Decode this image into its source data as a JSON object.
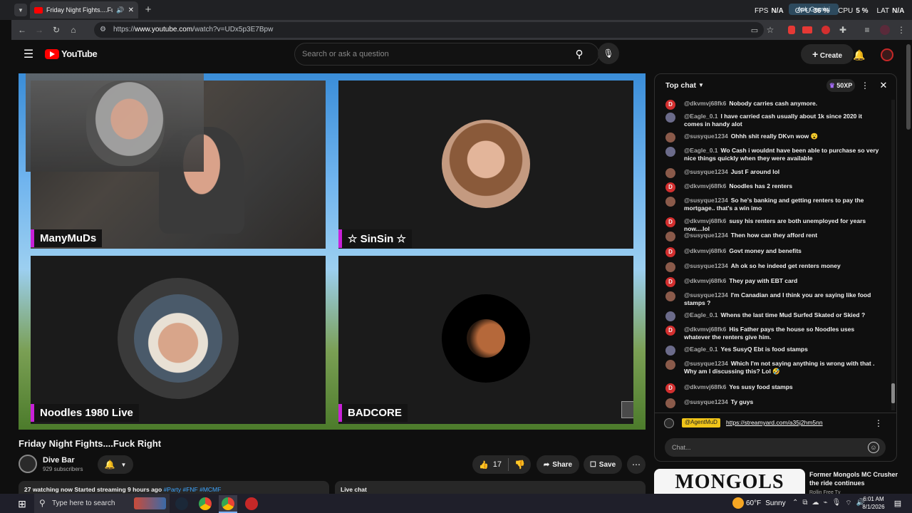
{
  "browser": {
    "tab_title": "Friday Night Fights....Fuck R",
    "url": "https://www.youtube.com/watch?v=UDx5p3E7Bpw",
    "url_prefix": "https://",
    "url_domain": "www.youtube.com",
    "url_path": "/watch?v=UDx5p3E7Bpw",
    "ask_label": "Ask Gemini",
    "perf": {
      "fps_label": "FPS",
      "fps": "N/A",
      "gpu_label": "GPU",
      "gpu": "36 %",
      "cpu_label": "CPU",
      "cpu": "5 %",
      "lat_label": "LAT",
      "lat": "N/A"
    }
  },
  "youtube": {
    "logo": "YouTube",
    "search_placeholder": "Search or ask a question",
    "create_label": "Create"
  },
  "video": {
    "participants": [
      {
        "name": "ManyMuDs"
      },
      {
        "name": "☆ SinSin ☆"
      },
      {
        "name": "Noodles 1980 Live"
      },
      {
        "name": "BADCORE"
      }
    ],
    "title": "Friday Night Fights....Fuck Right",
    "channel_name": "Dive Bar",
    "subscribers": "929 subscribers",
    "likes": "17",
    "share_label": "Share",
    "save_label": "Save",
    "stats": "27 watching now  Started streaming 9 hours ago",
    "hashtags": "#Party #FNF #MCMF",
    "live_chat_label": "Live chat"
  },
  "chat": {
    "mode": "Top chat",
    "xp": "50XP",
    "pinned_user": "@AgentMuD",
    "pinned_link": "https://streamyard.com/a35j2hm5nn",
    "input_placeholder": "Chat...",
    "messages": [
      {
        "user": "@dkvmvj68fk6",
        "text": "Nobody carries cash anymore.",
        "avatar": "D",
        "color": "#d32f2f"
      },
      {
        "user": "@Eagle_0.1",
        "text": "I have carried cash usually about 1k since 2020 it comes in handy alot",
        "avatar": "",
        "color": "#6b6b8a"
      },
      {
        "user": "@susyque1234",
        "text": "Ohhh shit really DKvn wow 😮",
        "avatar": "",
        "color": "#8a5a4a"
      },
      {
        "user": "@Eagle_0.1",
        "text": "Wo Cash i wouldnt have been able to purchase so very nice things quickly when they were available",
        "avatar": "",
        "color": "#6b6b8a"
      },
      {
        "user": "@susyque1234",
        "text": "Just F around lol",
        "avatar": "",
        "color": "#8a5a4a"
      },
      {
        "user": "@dkvmvj68fk6",
        "text": "Noodles has 2 renters",
        "avatar": "D",
        "color": "#d32f2f"
      },
      {
        "user": "@susyque1234",
        "text": "So he's banking and getting renters to pay the mortgage.. that's a win imo",
        "avatar": "",
        "color": "#8a5a4a"
      },
      {
        "user": "@dkvmvj68fk6",
        "text": "susy his renters are both unemployed for years now....lol",
        "avatar": "D",
        "color": "#d32f2f"
      },
      {
        "user": "@susyque1234",
        "text": "Then how can they afford rent",
        "avatar": "",
        "color": "#8a5a4a"
      },
      {
        "user": "@dkvmvj68fk6",
        "text": "Govt money and benefits",
        "avatar": "D",
        "color": "#d32f2f"
      },
      {
        "user": "@susyque1234",
        "text": "Ah ok so he indeed get renters money",
        "avatar": "",
        "color": "#8a5a4a"
      },
      {
        "user": "@dkvmvj68fk6",
        "text": "They pay with EBT card",
        "avatar": "D",
        "color": "#d32f2f"
      },
      {
        "user": "@susyque1234",
        "text": "I'm Canadian and I think you are saying like food stamps ?",
        "avatar": "",
        "color": "#8a5a4a"
      },
      {
        "user": "@Eagle_0.1",
        "text": "Whens the last time Mud Surfed Skated or Skied ?",
        "avatar": "",
        "color": "#6b6b8a"
      },
      {
        "user": "@dkvmvj68fk6",
        "text": "His Father pays the house so Noodles uses whatever the renters give him.",
        "avatar": "D",
        "color": "#d32f2f"
      },
      {
        "user": "@Eagle_0.1",
        "text": "Yes SusyQ Ebt is food stamps",
        "avatar": "",
        "color": "#6b6b8a"
      },
      {
        "user": "@susyque1234",
        "text": "Which I'm not saying anything is wrong with that . Why am I discussing this? Lol 🤣",
        "avatar": "",
        "color": "#8a5a4a"
      },
      {
        "user": "@dkvmvj68fk6",
        "text": "Yes susy food stamps",
        "avatar": "D",
        "color": "#d32f2f"
      },
      {
        "user": "@susyque1234",
        "text": "Ty guys",
        "avatar": "",
        "color": "#8a5a4a"
      }
    ]
  },
  "recommended": {
    "ad_text": "MONGOLS",
    "title": "Former Mongols MC Crusher the ride continues",
    "channel": "Rollin Free Tv"
  },
  "taskbar": {
    "search_placeholder": "Type here to search",
    "weather_temp": "60°F",
    "weather_desc": "Sunny",
    "time": "6:01 AM",
    "date": "8/1/2026"
  }
}
